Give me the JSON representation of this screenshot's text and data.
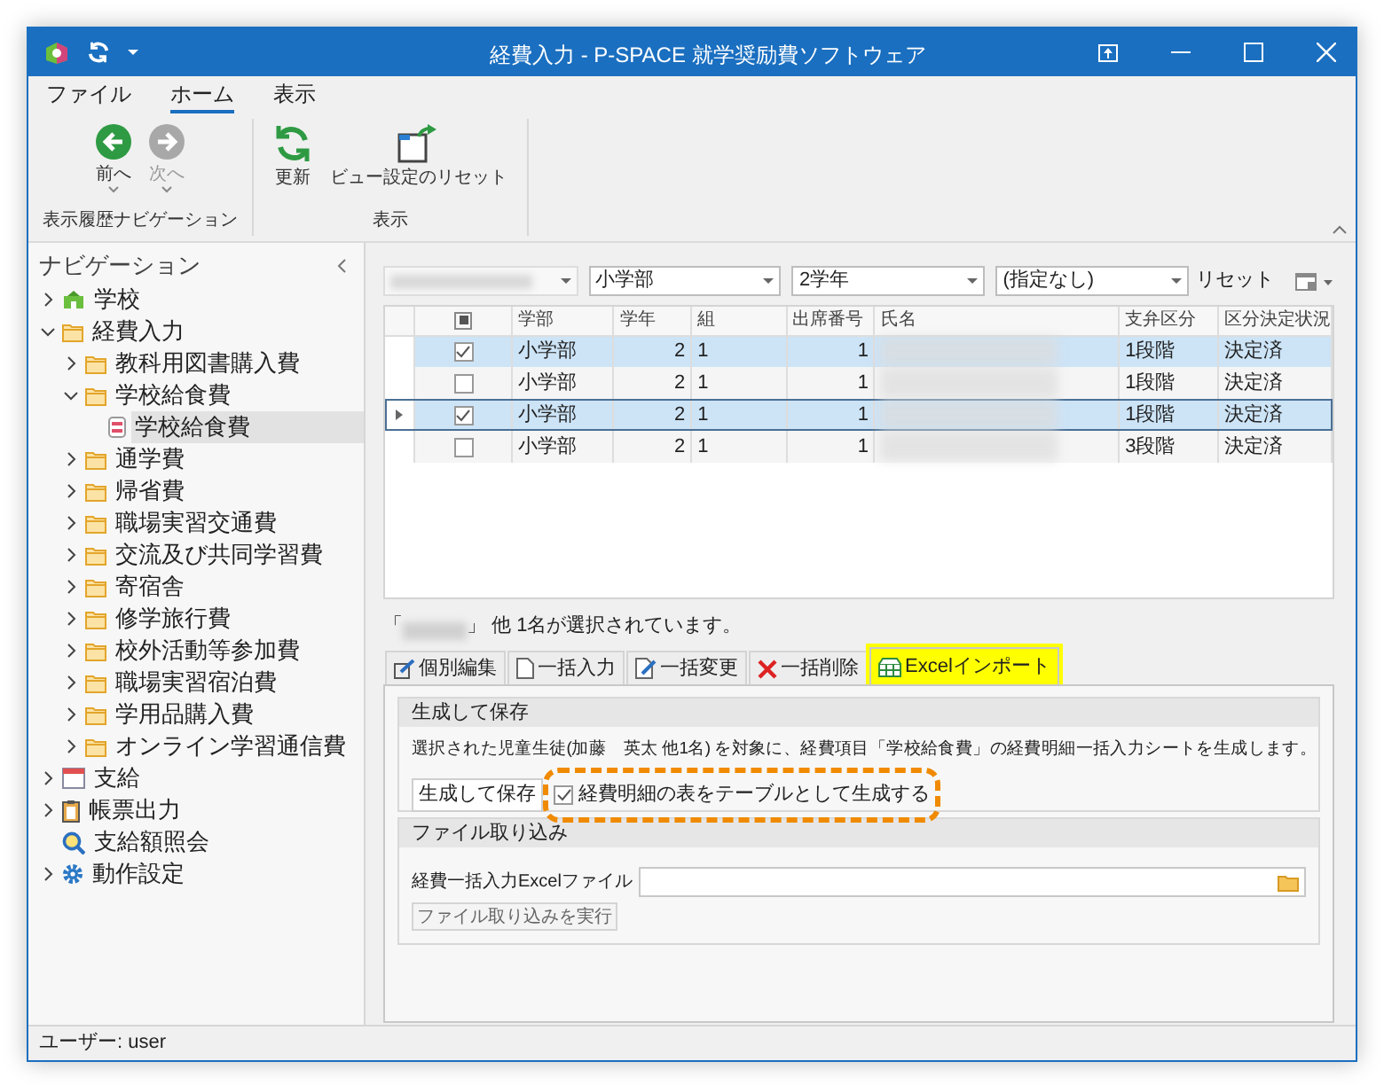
{
  "window": {
    "title": "経費入力 - P-SPACE 就学奨励費ソフトウェア"
  },
  "ribbon": {
    "tabs": [
      {
        "label": "ファイル",
        "selected": false
      },
      {
        "label": "ホーム",
        "selected": true
      },
      {
        "label": "表示",
        "selected": false
      }
    ],
    "groups": [
      {
        "label": "表示履歴ナビゲーション",
        "buttons": [
          {
            "label": "前へ",
            "kind": "back",
            "disabled": false,
            "dropdown": true
          },
          {
            "label": "次へ",
            "kind": "forward",
            "disabled": true,
            "dropdown": true
          }
        ]
      },
      {
        "label": "表示",
        "buttons": [
          {
            "label": "更新",
            "kind": "refresh",
            "disabled": false,
            "dropdown": false
          },
          {
            "label": "ビュー設定のリセット",
            "kind": "reset-view",
            "disabled": false,
            "dropdown": false
          }
        ]
      }
    ]
  },
  "navigation": {
    "title": "ナビゲーション",
    "items": [
      {
        "label": "学校",
        "kind": "school",
        "expanded": false,
        "selected": false
      },
      {
        "label": "経費入力",
        "kind": "folder",
        "expanded": true,
        "selected": false,
        "children": [
          {
            "label": "教科用図書購入費",
            "kind": "folder",
            "expanded": false,
            "selected": false
          },
          {
            "label": "学校給食費",
            "kind": "folder",
            "expanded": true,
            "selected": false,
            "children": [
              {
                "label": "学校給食費",
                "kind": "form",
                "selected": true
              }
            ]
          },
          {
            "label": "通学費",
            "kind": "folder",
            "expanded": false,
            "selected": false
          },
          {
            "label": "帰省費",
            "kind": "folder",
            "expanded": false,
            "selected": false
          },
          {
            "label": "職場実習交通費",
            "kind": "folder",
            "expanded": false,
            "selected": false
          },
          {
            "label": "交流及び共同学習費",
            "kind": "folder",
            "expanded": false,
            "selected": false
          },
          {
            "label": "寄宿舎",
            "kind": "folder",
            "expanded": false,
            "selected": false
          },
          {
            "label": "修学旅行費",
            "kind": "folder",
            "expanded": false,
            "selected": false
          },
          {
            "label": "校外活動等参加費",
            "kind": "folder",
            "expanded": false,
            "selected": false
          },
          {
            "label": "職場実習宿泊費",
            "kind": "folder",
            "expanded": false,
            "selected": false
          },
          {
            "label": "学用品購入費",
            "kind": "folder",
            "expanded": false,
            "selected": false
          },
          {
            "label": "オンライン学習通信費",
            "kind": "folder",
            "expanded": false,
            "selected": false
          }
        ]
      },
      {
        "label": "支給",
        "kind": "calendar",
        "expanded": false,
        "selected": false
      },
      {
        "label": "帳票出力",
        "kind": "clipboard",
        "expanded": false,
        "selected": false
      },
      {
        "label": "支給額照会",
        "kind": "search",
        "selected": false
      },
      {
        "label": "動作設定",
        "kind": "gear",
        "expanded": false,
        "selected": false
      }
    ]
  },
  "filters": [
    {
      "kind": "redacted"
    },
    {
      "kind": "combo",
      "value": "小学部"
    },
    {
      "kind": "combo",
      "value": "2学年"
    },
    {
      "kind": "combo",
      "value": "(指定なし)"
    }
  ],
  "reset_button": "リセット",
  "table": {
    "select_all_indeterminate": true,
    "columns": [
      "学部",
      "学年",
      "組",
      "出席番号",
      "氏名",
      "支弁区分",
      "区分決定状況"
    ],
    "rows": [
      {
        "selected": true,
        "current": false,
        "checked": true,
        "department": "小学部",
        "grade": "2",
        "class": "1",
        "number": "1",
        "support": "1段階",
        "status": "決定済"
      },
      {
        "selected": false,
        "current": false,
        "checked": false,
        "department": "小学部",
        "grade": "2",
        "class": "1",
        "number": "1",
        "support": "1段階",
        "status": "決定済"
      },
      {
        "selected": true,
        "current": true,
        "checked": true,
        "department": "小学部",
        "grade": "2",
        "class": "1",
        "number": "1",
        "support": "1段階",
        "status": "決定済"
      },
      {
        "selected": false,
        "current": false,
        "checked": false,
        "department": "小学部",
        "grade": "2",
        "class": "1",
        "number": "1",
        "support": "3段階",
        "status": "決定済"
      }
    ]
  },
  "selection_text": {
    "open": "「",
    "rest": "」 他 1名が選択されています。"
  },
  "tabs": [
    {
      "label": "個別編集",
      "kind": "edit",
      "selected": false,
      "highlighted": false
    },
    {
      "label": "一括入力",
      "kind": "doc",
      "selected": false,
      "highlighted": false
    },
    {
      "label": "一括変更",
      "kind": "doc-edit",
      "selected": false,
      "highlighted": false
    },
    {
      "label": "一括削除",
      "kind": "delete",
      "selected": false,
      "highlighted": false
    },
    {
      "label": "Excelインポート",
      "kind": "import",
      "selected": true,
      "highlighted": true
    }
  ],
  "generate": {
    "title": "生成して保存",
    "description": "選択された児童生徒(加藤　英太 他1名) を対象に、経費項目「学校給食費」の経費明細一括入力シートを生成します。",
    "button": "生成して保存",
    "checkbox": {
      "label": "経費明細の表をテーブルとして生成する",
      "checked": true,
      "highlighted": true
    }
  },
  "file_import": {
    "title": "ファイル取り込み",
    "field_label": "経費一括入力Excelファイル",
    "button": "ファイル取り込みを実行"
  },
  "status_bar": "ユーザー: user"
}
